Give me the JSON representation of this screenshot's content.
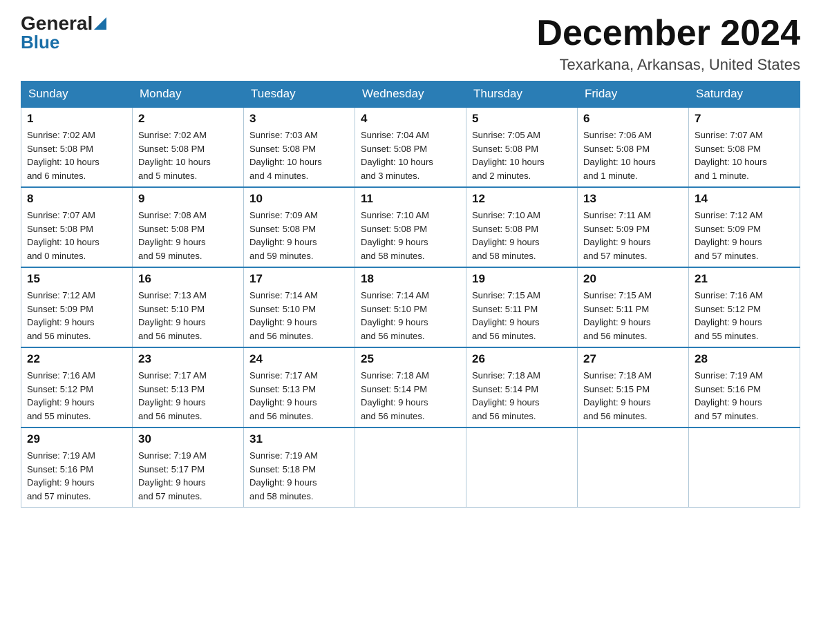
{
  "logo": {
    "text_general": "General",
    "text_blue": "Blue",
    "arrow": "▲"
  },
  "header": {
    "month": "December 2024",
    "location": "Texarkana, Arkansas, United States"
  },
  "days_of_week": [
    "Sunday",
    "Monday",
    "Tuesday",
    "Wednesday",
    "Thursday",
    "Friday",
    "Saturday"
  ],
  "weeks": [
    [
      {
        "num": "1",
        "sunrise": "7:02 AM",
        "sunset": "5:08 PM",
        "daylight": "10 hours and 6 minutes."
      },
      {
        "num": "2",
        "sunrise": "7:02 AM",
        "sunset": "5:08 PM",
        "daylight": "10 hours and 5 minutes."
      },
      {
        "num": "3",
        "sunrise": "7:03 AM",
        "sunset": "5:08 PM",
        "daylight": "10 hours and 4 minutes."
      },
      {
        "num": "4",
        "sunrise": "7:04 AM",
        "sunset": "5:08 PM",
        "daylight": "10 hours and 3 minutes."
      },
      {
        "num": "5",
        "sunrise": "7:05 AM",
        "sunset": "5:08 PM",
        "daylight": "10 hours and 2 minutes."
      },
      {
        "num": "6",
        "sunrise": "7:06 AM",
        "sunset": "5:08 PM",
        "daylight": "10 hours and 1 minute."
      },
      {
        "num": "7",
        "sunrise": "7:07 AM",
        "sunset": "5:08 PM",
        "daylight": "10 hours and 1 minute."
      }
    ],
    [
      {
        "num": "8",
        "sunrise": "7:07 AM",
        "sunset": "5:08 PM",
        "daylight": "10 hours and 0 minutes."
      },
      {
        "num": "9",
        "sunrise": "7:08 AM",
        "sunset": "5:08 PM",
        "daylight": "9 hours and 59 minutes."
      },
      {
        "num": "10",
        "sunrise": "7:09 AM",
        "sunset": "5:08 PM",
        "daylight": "9 hours and 59 minutes."
      },
      {
        "num": "11",
        "sunrise": "7:10 AM",
        "sunset": "5:08 PM",
        "daylight": "9 hours and 58 minutes."
      },
      {
        "num": "12",
        "sunrise": "7:10 AM",
        "sunset": "5:08 PM",
        "daylight": "9 hours and 58 minutes."
      },
      {
        "num": "13",
        "sunrise": "7:11 AM",
        "sunset": "5:09 PM",
        "daylight": "9 hours and 57 minutes."
      },
      {
        "num": "14",
        "sunrise": "7:12 AM",
        "sunset": "5:09 PM",
        "daylight": "9 hours and 57 minutes."
      }
    ],
    [
      {
        "num": "15",
        "sunrise": "7:12 AM",
        "sunset": "5:09 PM",
        "daylight": "9 hours and 56 minutes."
      },
      {
        "num": "16",
        "sunrise": "7:13 AM",
        "sunset": "5:10 PM",
        "daylight": "9 hours and 56 minutes."
      },
      {
        "num": "17",
        "sunrise": "7:14 AM",
        "sunset": "5:10 PM",
        "daylight": "9 hours and 56 minutes."
      },
      {
        "num": "18",
        "sunrise": "7:14 AM",
        "sunset": "5:10 PM",
        "daylight": "9 hours and 56 minutes."
      },
      {
        "num": "19",
        "sunrise": "7:15 AM",
        "sunset": "5:11 PM",
        "daylight": "9 hours and 56 minutes."
      },
      {
        "num": "20",
        "sunrise": "7:15 AM",
        "sunset": "5:11 PM",
        "daylight": "9 hours and 56 minutes."
      },
      {
        "num": "21",
        "sunrise": "7:16 AM",
        "sunset": "5:12 PM",
        "daylight": "9 hours and 55 minutes."
      }
    ],
    [
      {
        "num": "22",
        "sunrise": "7:16 AM",
        "sunset": "5:12 PM",
        "daylight": "9 hours and 55 minutes."
      },
      {
        "num": "23",
        "sunrise": "7:17 AM",
        "sunset": "5:13 PM",
        "daylight": "9 hours and 56 minutes."
      },
      {
        "num": "24",
        "sunrise": "7:17 AM",
        "sunset": "5:13 PM",
        "daylight": "9 hours and 56 minutes."
      },
      {
        "num": "25",
        "sunrise": "7:18 AM",
        "sunset": "5:14 PM",
        "daylight": "9 hours and 56 minutes."
      },
      {
        "num": "26",
        "sunrise": "7:18 AM",
        "sunset": "5:14 PM",
        "daylight": "9 hours and 56 minutes."
      },
      {
        "num": "27",
        "sunrise": "7:18 AM",
        "sunset": "5:15 PM",
        "daylight": "9 hours and 56 minutes."
      },
      {
        "num": "28",
        "sunrise": "7:19 AM",
        "sunset": "5:16 PM",
        "daylight": "9 hours and 57 minutes."
      }
    ],
    [
      {
        "num": "29",
        "sunrise": "7:19 AM",
        "sunset": "5:16 PM",
        "daylight": "9 hours and 57 minutes."
      },
      {
        "num": "30",
        "sunrise": "7:19 AM",
        "sunset": "5:17 PM",
        "daylight": "9 hours and 57 minutes."
      },
      {
        "num": "31",
        "sunrise": "7:19 AM",
        "sunset": "5:18 PM",
        "daylight": "9 hours and 58 minutes."
      },
      null,
      null,
      null,
      null
    ]
  ],
  "labels": {
    "sunrise": "Sunrise:",
    "sunset": "Sunset:",
    "daylight": "Daylight:"
  }
}
